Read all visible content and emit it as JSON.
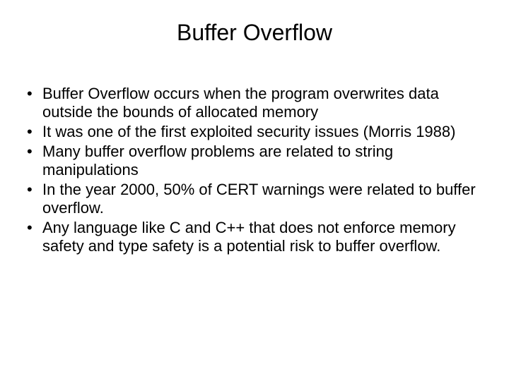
{
  "slide": {
    "title": "Buffer Overflow",
    "bullets": [
      "Buffer Overflow occurs when the program overwrites data outside the bounds of allocated memory",
      "It was one of the first exploited security issues (Morris 1988)",
      "Many buffer overflow problems are related to string manipulations",
      "In the year 2000, 50% of CERT warnings were related to buffer overflow.",
      "Any language like C and C++ that does not enforce memory safety and type safety is a potential risk to buffer overflow."
    ]
  }
}
